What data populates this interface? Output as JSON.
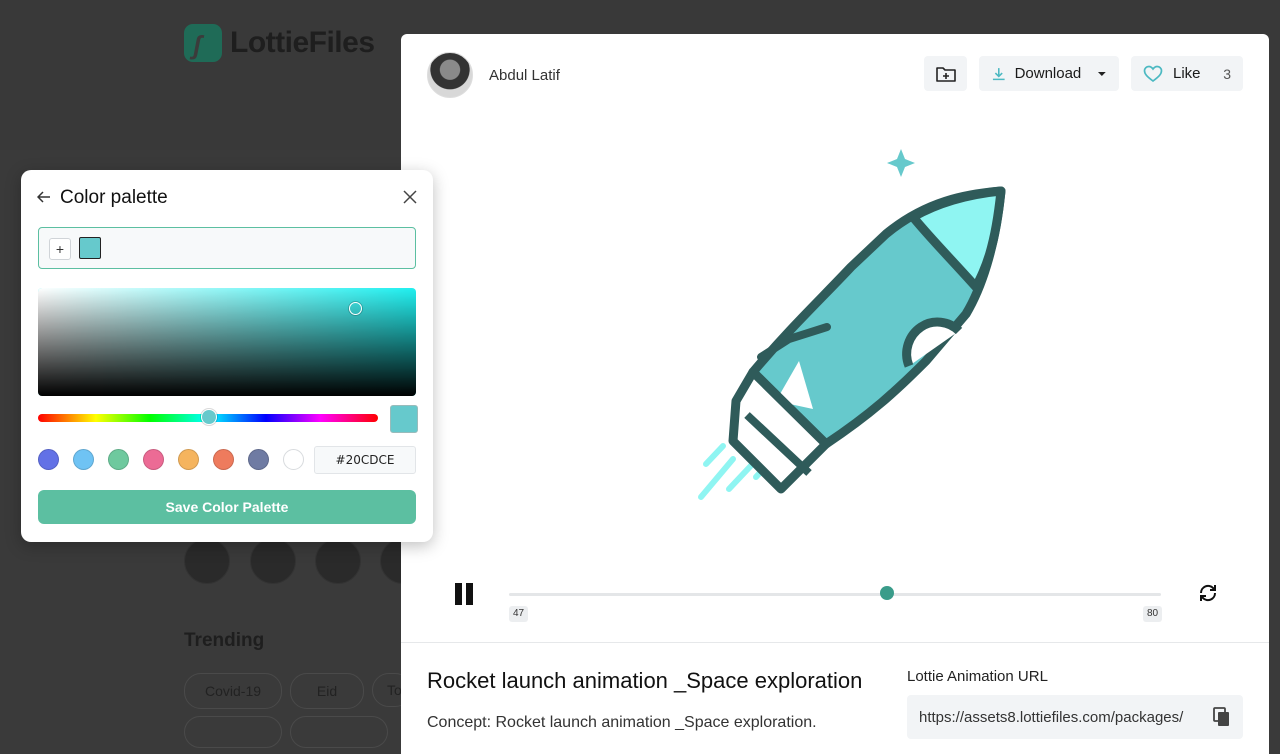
{
  "background": {
    "logo_text": "LottieFiles",
    "trending_label": "Trending",
    "chips": [
      "Covid-19",
      "Eid",
      "To"
    ]
  },
  "author": {
    "name": "Abdul Latif"
  },
  "actions": {
    "download_label": "Download",
    "like_label": "Like",
    "like_count": "3"
  },
  "player": {
    "frame_start": "47",
    "frame_end": "80",
    "progress_percent": 58
  },
  "info": {
    "title": "Rocket launch animation _Space exploration",
    "description": "Concept: Rocket launch animation _Space exploration.",
    "url_label": "Lottie Animation URL",
    "url_value": "https://assets8.lottiefiles.com/packages/"
  },
  "palette": {
    "title": "Color palette",
    "hex_value": "#20CDCE",
    "save_label": "Save Color Palette",
    "current_color": "#66c9cc",
    "sv_hue_color": "#20f0f0",
    "hue_position_percent": 50,
    "presets": [
      "#6271e6",
      "#6fc3f4",
      "#6ec99e",
      "#ec6b95",
      "#f5b45e",
      "#ee7b5d",
      "#6f7ba3",
      "#ffffff"
    ]
  },
  "colors": {
    "accent": "#5cbfa1",
    "rocket_fill": "#66c9cc",
    "rocket_stroke": "#2f5b5a",
    "rocket_window": "#8ff5f2"
  }
}
